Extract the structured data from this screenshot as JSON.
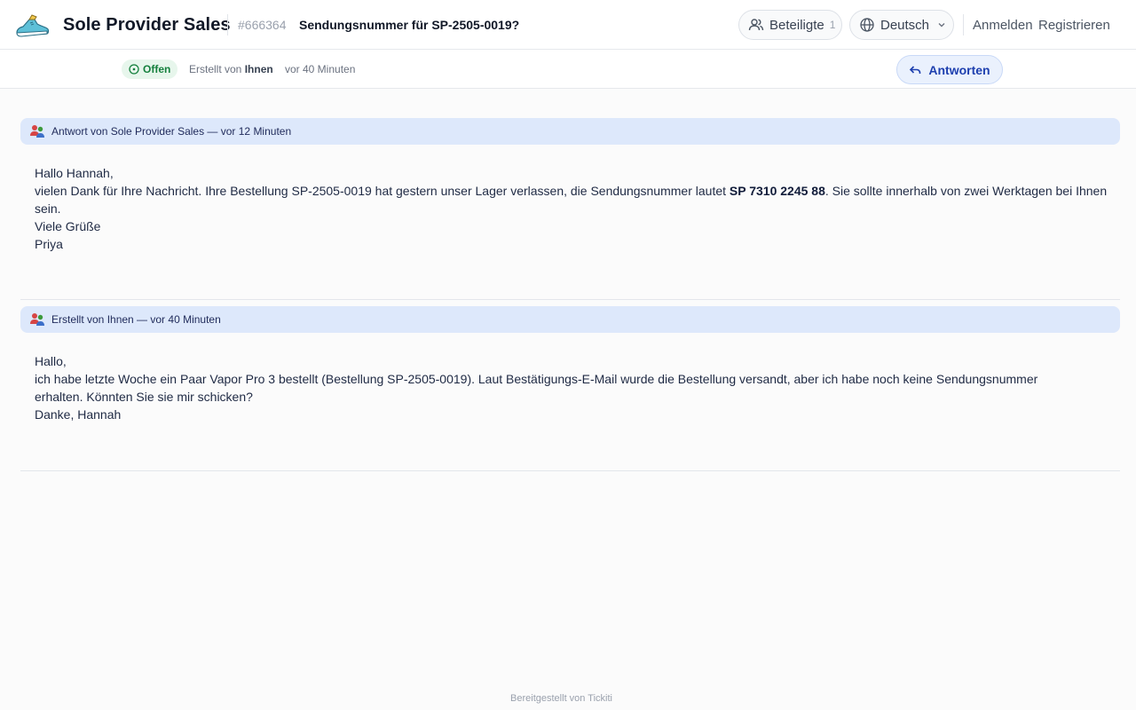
{
  "header": {
    "brand": "Sole Provider Sales",
    "ticket_id": "#666364",
    "ticket_title": "Sendungsnummer für SP-2505-0019?",
    "participants_label": "Beteiligte",
    "participants_count": "1",
    "language_label": "Deutsch",
    "login_label": "Anmelden",
    "register_label": "Registrieren"
  },
  "subbar": {
    "status": "Offen",
    "created_prefix": "Erstellt von",
    "created_by": "Ihnen",
    "created_ago": "vor 40 Minuten",
    "reply_label": "Antworten"
  },
  "messages": [
    {
      "header": "Antwort von Sole Provider Sales — vor 12 Minuten",
      "greeting": "Hallo Hannah,",
      "text_before": "vielen Dank für Ihre Nachricht. Ihre Bestellung SP-2505-0019 hat gestern unser Lager verlassen, die Sendungsnummer lautet ",
      "tracking": "SP 7310 2245 88",
      "text_after": ". Sie sollte innerhalb von zwei Werktagen bei Ihnen sein.",
      "closing": "Viele Grüße",
      "signature": "Priya"
    },
    {
      "header": "Erstellt von Ihnen — vor 40 Minuten",
      "greeting": "Hallo,",
      "text": "ich habe letzte Woche ein Paar Vapor Pro 3 bestellt (Bestellung SP-2505-0019). Laut Bestätigungs-E-Mail wurde die Bestellung versandt, aber ich habe noch keine Sendungsnummer erhalten. Könnten Sie sie mir schicken?",
      "signature": "Danke, Hannah"
    }
  ],
  "footer": "Bereitgestellt von Tickiti",
  "icons": {
    "logo": "sneaker-logo-icon",
    "participants": "users-icon",
    "language": "globe-icon",
    "dropdown": "chevron-down-icon",
    "status": "open-circle-icon",
    "reply": "reply-arrow-icon",
    "message": "people-group-icon"
  },
  "colors": {
    "accent": "#1e40af",
    "status_green": "#15803d",
    "message_header_bg": "#dde8fb"
  }
}
